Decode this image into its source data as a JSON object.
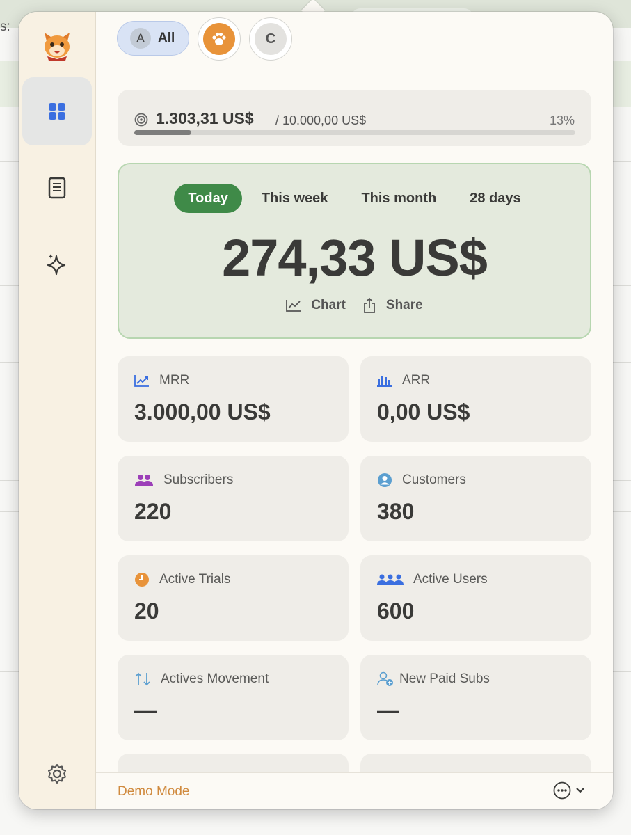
{
  "background": {
    "label": "s:"
  },
  "chips": {
    "all_letter": "A",
    "all_label": "All",
    "c_letter": "C"
  },
  "goal": {
    "value": "1.303,31 US$",
    "target": "/ 10.000,00 US$",
    "percent": "13%",
    "progress": 0.13
  },
  "revenue": {
    "tabs": [
      "Today",
      "This week",
      "This month",
      "28 days"
    ],
    "active_tab": "Today",
    "value": "274,33 US$",
    "chart_label": "Chart",
    "share_label": "Share"
  },
  "metrics": [
    {
      "label": "MRR",
      "value": "3.000,00 US$",
      "icon": "trend-up-icon"
    },
    {
      "label": "ARR",
      "value": "0,00 US$",
      "icon": "bar-chart-icon"
    },
    {
      "label": "Subscribers",
      "value": "220",
      "icon": "people-icon"
    },
    {
      "label": "Customers",
      "value": "380",
      "icon": "person-circle-icon"
    },
    {
      "label": "Active Trials",
      "value": "20",
      "icon": "clock-icon"
    },
    {
      "label": "Active Users",
      "value": "600",
      "icon": "group-icon"
    },
    {
      "label": "Actives Movement",
      "value": "—",
      "icon": "arrows-updown-icon"
    },
    {
      "label": "New Paid Subs",
      "value": "—",
      "icon": "person-add-icon"
    }
  ],
  "footer": {
    "demo_label": "Demo Mode"
  },
  "colors": {
    "accent_green": "#3f8a48",
    "accent_blue": "#3b6fe0",
    "demo_orange": "#d08a3e",
    "paw_orange": "#e8933a"
  }
}
